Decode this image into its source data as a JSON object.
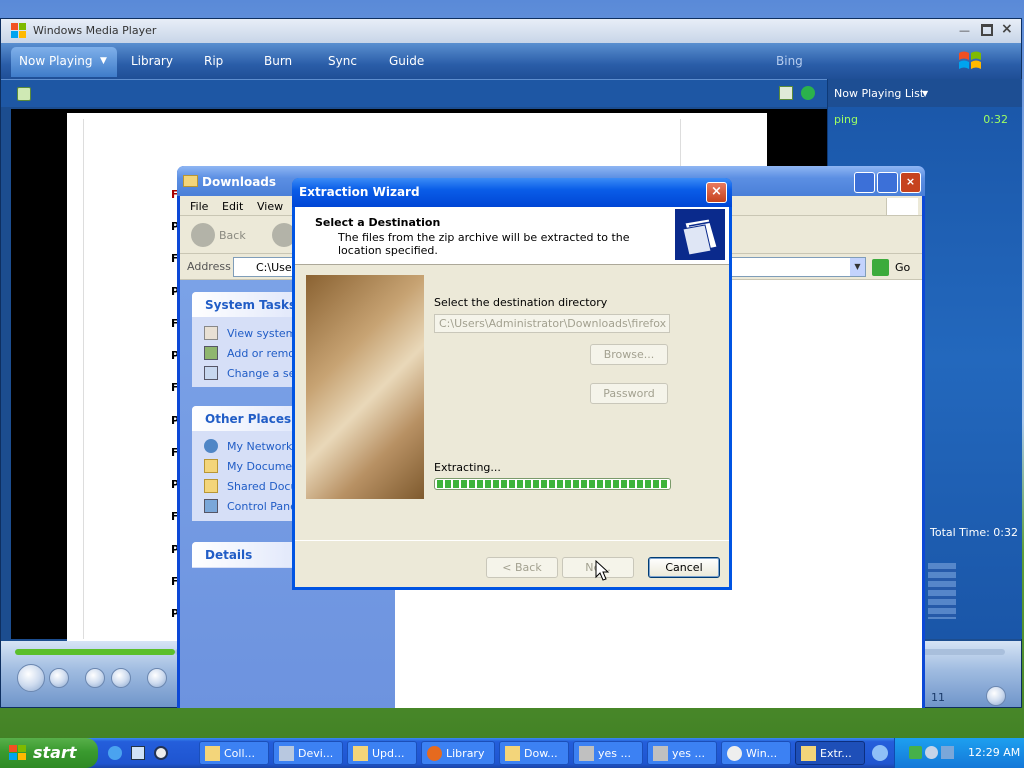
{
  "wmp": {
    "title": "Windows Media Player",
    "tabs": [
      "Now Playing",
      "Library",
      "Rip",
      "Burn",
      "Sync",
      "Guide"
    ],
    "bing": "Bing",
    "now_playing_list": "Now Playing List",
    "playlist": [
      {
        "title": "ping",
        "duration": "0:32"
      }
    ],
    "total_time": "Total Time: 0:32",
    "time_display": "11"
  },
  "doc": {
    "lines": [
      "F",
      "Ping",
      "F",
      "Ping",
      "F",
      "Ping",
      "F|",
      "Ping",
      "F",
      "Ping",
      "F",
      "Ping",
      "F",
      "Ping"
    ]
  },
  "explorer": {
    "title": "Downloads",
    "menu": [
      "File",
      "Edit",
      "View"
    ],
    "back": "Back",
    "address_label": "Address",
    "address_value": "C:\\User",
    "go": "Go",
    "system_tasks": {
      "header": "System Tasks",
      "items": [
        "View system i",
        "Add or remov",
        "Change a set"
      ]
    },
    "other_places": {
      "header": "Other Places",
      "items": [
        "My Network P",
        "My Documen",
        "Shared Docu",
        "Control Panel"
      ]
    },
    "details": "Details"
  },
  "wizard": {
    "title": "Extraction Wizard",
    "heading": "Select a Destination",
    "subheading": "The files from the zip archive will be extracted to the location specified.",
    "dest_label": "Select the destination directory",
    "dest_value": "C:\\Users\\Administrator\\Downloads\\firefox",
    "browse": "Browse...",
    "password": "Password",
    "status": "Extracting...",
    "progress": 1.0,
    "back": "< Back",
    "next": "Ne...",
    "cancel": "Cancel"
  },
  "taskbar": {
    "start": "start",
    "items": [
      "Coll...",
      "Devi...",
      "Upd...",
      "Library",
      "Dow...",
      "yes ...",
      "yes ...",
      "Win...",
      "Extr..."
    ],
    "clock": "12:29 AM"
  }
}
